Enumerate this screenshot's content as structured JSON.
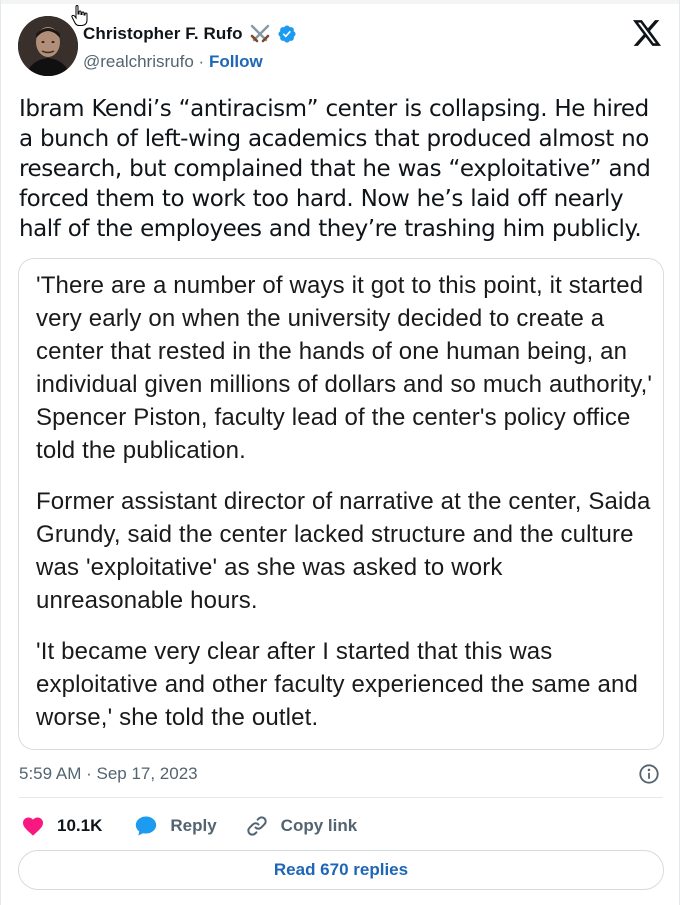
{
  "author": {
    "name": "Christopher F. Rufo",
    "handle": "@realchrisrufo",
    "separator": "·",
    "follow_label": "Follow"
  },
  "tweet": {
    "text": "Ibram Kendi’s “antiracism” center is collapsing. He hired a bunch of left-wing academics that produced almost no research, but complained that he was “exploitative” and forced them to work too hard. Now he’s laid off nearly half of the employees and they’re trashing him publicly.",
    "timestamp": "5:59 AM · Sep 17, 2023"
  },
  "media": {
    "paragraphs": [
      "'There are a number of ways it got to this point, it started very early on when the university decided to create a center that rested in the hands of one human being, an individual given millions of dollars and so much authority,' Spencer Piston, faculty lead of the center's policy office told the publication.",
      "Former assistant director of narrative at the center, Saida Grundy, said the center lacked structure and the culture was 'exploitative' as she was asked to work unreasonable hours.",
      "'It became very clear after I started that this was exploitative and other faculty experienced the same and worse,' she told the outlet."
    ]
  },
  "actions": {
    "like_count": "10.1K",
    "reply_label": "Reply",
    "copy_link_label": "Copy link"
  },
  "replies_button_label": "Read 670 replies",
  "icons": {
    "cursor": "hand-pointer-icon",
    "swords": "crossed-swords-icon",
    "verified": "verified-badge-icon",
    "logo": "x-logo-icon",
    "info": "info-icon",
    "like": "heart-icon",
    "reply": "speech-bubble-icon",
    "copy": "link-icon"
  },
  "colors": {
    "accent_blue": "#1d67b6",
    "verified_blue": "#1d9bf0",
    "like_pink": "#f91880",
    "text_primary": "#0f1419",
    "text_secondary": "#536471"
  }
}
